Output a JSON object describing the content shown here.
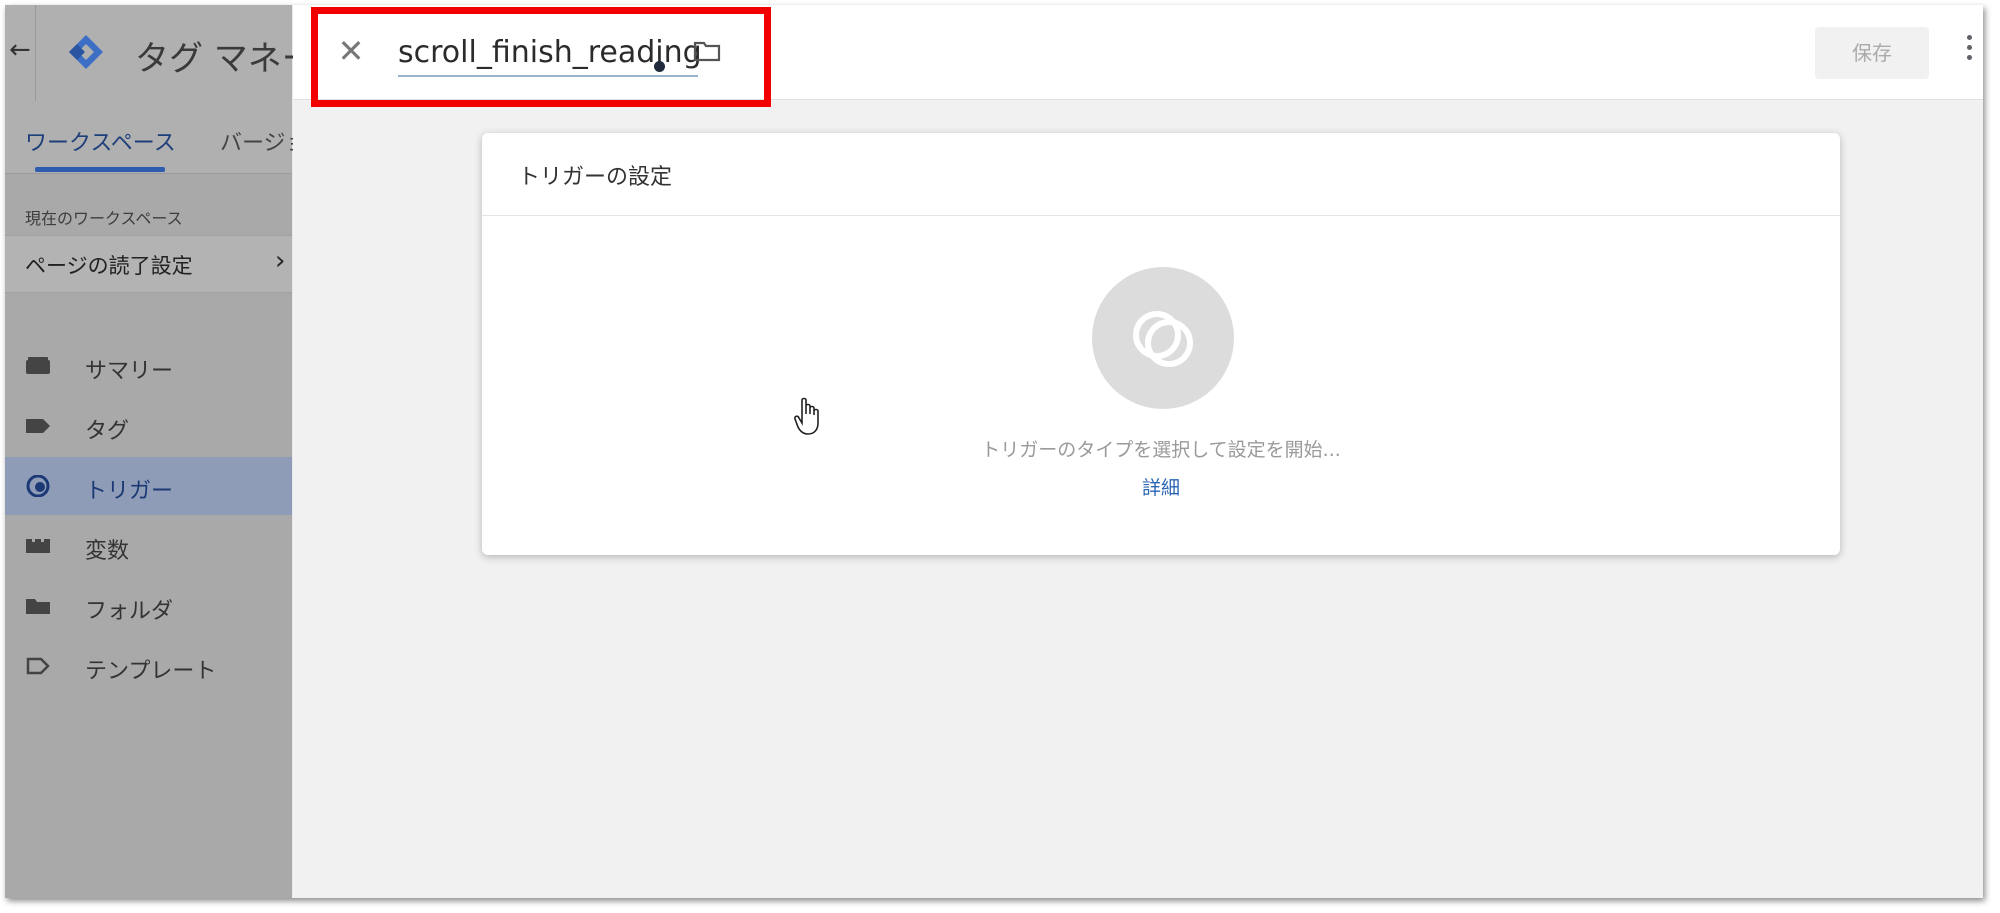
{
  "app": {
    "title": "タグ マネー",
    "tabs": [
      {
        "label": "ワークスペース"
      },
      {
        "label": "バージョ"
      }
    ]
  },
  "workspace": {
    "label": "現在のワークスペース",
    "name": "ページの読了設定"
  },
  "sidebar": {
    "items": [
      {
        "label": "サマリー",
        "icon": "summary-icon"
      },
      {
        "label": "タグ",
        "icon": "tag-icon"
      },
      {
        "label": "トリガー",
        "icon": "trigger-icon",
        "active": true
      },
      {
        "label": "変数",
        "icon": "variables-icon"
      },
      {
        "label": "フォルダ",
        "icon": "folder-icon"
      },
      {
        "label": "テンプレート",
        "icon": "template-icon"
      }
    ]
  },
  "editor": {
    "name": "scroll_finish_reading",
    "save_label": "保存",
    "card_title": "トリガーの設定",
    "hint": "トリガーのタイプを選択して設定を開始...",
    "detail_link": "詳細"
  },
  "colors": {
    "highlight": "#f20000",
    "link": "#2a66b5",
    "active_nav": "#8f9cb7"
  }
}
